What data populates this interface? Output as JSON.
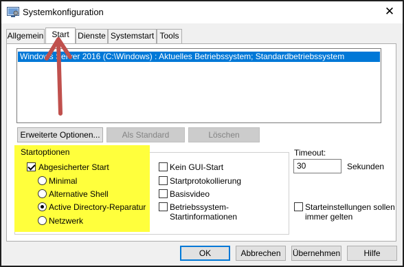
{
  "window": {
    "title": "Systemkonfiguration",
    "close_glyph": "✕",
    "icon": "msconfig-icon"
  },
  "tabs": [
    {
      "label": "Allgemein",
      "active": false
    },
    {
      "label": "Start",
      "active": true
    },
    {
      "label": "Dienste",
      "active": false
    },
    {
      "label": "Systemstart",
      "active": false
    },
    {
      "label": "Tools",
      "active": false
    }
  ],
  "boot_list": {
    "selected": "Windows Server 2016 (C:\\Windows) : Aktuelles Betriebssystem; Standardbetriebssystem"
  },
  "list_buttons": {
    "advanced": "Erweiterte Optionen...",
    "set_default": "Als Standard",
    "delete": "Löschen"
  },
  "boot_options": {
    "title": "Startoptionen",
    "safe_boot": {
      "label": "Abgesicherter Start",
      "checked": true
    },
    "radios": [
      {
        "label": "Minimal",
        "checked": false
      },
      {
        "label": "Alternative Shell",
        "checked": false
      },
      {
        "label": "Active Directory-Reparatur",
        "checked": true
      },
      {
        "label": "Netzwerk",
        "checked": false
      }
    ],
    "right_checks": [
      {
        "label": "Kein GUI-Start",
        "checked": false
      },
      {
        "label": "Startprotokollierung",
        "checked": false
      },
      {
        "label": "Basisvideo",
        "checked": false
      },
      {
        "label": "Betriebssystem-\nStartinformationen",
        "checked": false
      }
    ]
  },
  "timeout": {
    "label": "Timeout:",
    "value": "30",
    "unit": "Sekunden"
  },
  "persist": {
    "label": "Starteinstellungen sollen\nimmer gelten",
    "checked": false
  },
  "footer": {
    "ok": "OK",
    "cancel": "Abbrechen",
    "apply": "Übernehmen",
    "help": "Hilfe"
  },
  "colors": {
    "selection": "#0078d7",
    "highlight": "#ffff3c",
    "arrow": "#c0504d"
  }
}
